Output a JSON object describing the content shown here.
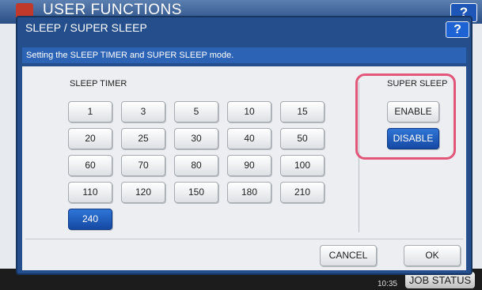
{
  "background": {
    "title": "USER FUNCTIONS",
    "help_label": "?",
    "clock_time": "10:35",
    "job_status_label": "JOB STATUS"
  },
  "dialog": {
    "title": "SLEEP / SUPER SLEEP",
    "help_label": "?",
    "instruction": "Setting the SLEEP TIMER and SUPER SLEEP mode."
  },
  "sleep_timer": {
    "label": "SLEEP TIMER",
    "options": [
      "1",
      "3",
      "5",
      "10",
      "15",
      "20",
      "25",
      "30",
      "40",
      "50",
      "60",
      "70",
      "80",
      "90",
      "100",
      "110",
      "120",
      "150",
      "180",
      "210",
      "240"
    ],
    "selected": "240"
  },
  "super_sleep": {
    "label": "SUPER SLEEP",
    "enable_label": "ENABLE",
    "disable_label": "DISABLE",
    "selected": "DISABLE"
  },
  "footer": {
    "cancel_label": "CANCEL",
    "ok_label": "OK"
  },
  "colors": {
    "accent": "#1e56b8",
    "selected": "#1549a3",
    "highlight": "#e2567a"
  }
}
